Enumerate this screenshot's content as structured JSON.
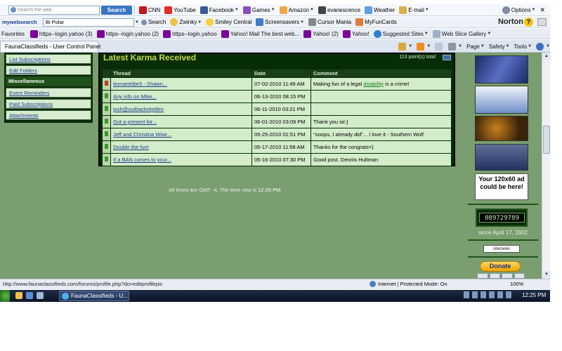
{
  "toolbar1": {
    "search_placeholder": "Search the web",
    "search_button": "Search",
    "cnn": "CNN",
    "youtube": "YouTube",
    "facebook": "Facebook",
    "games": "Games",
    "amazon": "Amazon",
    "evanescence": "evanescence",
    "weather": "Weather",
    "email": "E-mail",
    "options": "Options"
  },
  "toolbar2": {
    "mywebsearch_label": "mywebsearch",
    "search_value": "Bi Polar",
    "search_button": "Search",
    "zwinky": "Zwinky",
    "smiley_central": "Smiley Central",
    "screensavers": "Screensavers",
    "cursor_mania": "Cursor Mania",
    "myfuncards": "MyFunCards",
    "norton": "Norton"
  },
  "favorites": {
    "label": "Favorites",
    "items": [
      "https--login.yahoo (3)",
      "https--login.yahoo (2)",
      "https--login.yahoo",
      "Yahoo! Mail The best web...",
      "Yahoo! (2)",
      "Yahoo!",
      "Suggested Sites",
      "Web Slice Gallery"
    ]
  },
  "tab": {
    "title": "FaunaClassifieds - User Control Panel"
  },
  "command_bar": {
    "page": "Page",
    "safety": "Safety",
    "tools": "Tools"
  },
  "left_nav": {
    "items": [
      "List Subscriptions",
      "Edit Folders",
      "Miscellaneous",
      "Event Reminders",
      "Paid Subscriptions",
      "Attachments"
    ]
  },
  "karma": {
    "title": "Latest Karma Received",
    "total": "113 point(s) total",
    "headers": {
      "thread": "Thread",
      "date": "Date",
      "comment": "Comment"
    },
    "rows": [
      {
        "thread": "tinmantribe5 - Shawn...",
        "date": "07-02-2010 11:49 AM",
        "comment_pre": "Making fun of a legal ",
        "comment_kw": "disability",
        "comment_post": " is a crime!",
        "flag": "red"
      },
      {
        "thread": "Any info on Mike...",
        "date": "06-13-2010 08:15 PM",
        "comment_pre": "",
        "comment_kw": "",
        "comment_post": "",
        "flag": "green"
      },
      {
        "thread": "josh@outbackreptiles",
        "date": "06-11-2010 03:21 PM",
        "comment_pre": "",
        "comment_kw": "",
        "comment_post": "",
        "flag": "green"
      },
      {
        "thread": "Got a present for...",
        "date": "06-01-2010 03:09 PM",
        "comment_pre": "Thank you sir;)",
        "comment_kw": "",
        "comment_post": "",
        "flag": "green"
      },
      {
        "thread": "Jeff and Christina Wise...",
        "date": "05-25-2010 01:51 PM",
        "comment_pre": "\"ooops, I already did\"... I love it - Southern Wolf",
        "comment_kw": "",
        "comment_post": "",
        "flag": "green"
      },
      {
        "thread": "Double the fun!",
        "date": "05-17-2010 11:58 AM",
        "comment_pre": "Thanks for the congrats=)",
        "comment_kw": "",
        "comment_post": "",
        "flag": "green"
      },
      {
        "thread": "If a BAN comes to your...",
        "date": "05-16-2010 07:30 PM",
        "comment_pre": "Good post. Dennis Hultman",
        "comment_kw": "",
        "comment_post": "",
        "flag": "green"
      }
    ]
  },
  "timezone": {
    "text": "All times are GMT -4. The time now is ",
    "now": "12:25 PM"
  },
  "right_col": {
    "ad_placeholder": "Your 120x60 ad could be here!",
    "counter": "089729789",
    "since": "since April 17, 2002",
    "sitemeter": "sitemeter",
    "donate": "Donate"
  },
  "status": {
    "url": "http://www.faunaclassifieds.com/forums/profile.php?do=editprofilepic",
    "zone": "Internet | Protected Mode: On",
    "zoom": "100%"
  },
  "taskbar": {
    "window": "FaunaClassifieds - U...",
    "clock": "12:25 PM"
  }
}
